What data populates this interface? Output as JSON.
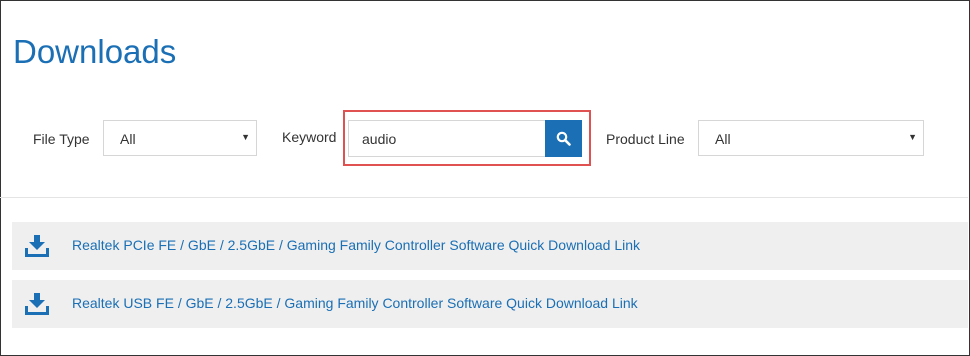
{
  "page": {
    "title": "Downloads"
  },
  "filters": {
    "file_type": {
      "label": "File Type",
      "value": "All"
    },
    "keyword": {
      "label": "Keyword",
      "value": "audio"
    },
    "product_line": {
      "label": "Product Line",
      "value": "All"
    }
  },
  "icons": {
    "search": "search-icon",
    "download": "download-icon",
    "caret": "caret-down-icon"
  },
  "colors": {
    "accent": "#1a6fb5",
    "highlight": "#e05252",
    "row_bg": "#efefef"
  },
  "downloads": [
    {
      "title": "Realtek PCIe FE / GbE / 2.5GbE / Gaming Family Controller Software Quick Download Link"
    },
    {
      "title": "Realtek USB FE / GbE / 2.5GbE / Gaming Family Controller Software Quick Download Link"
    }
  ]
}
